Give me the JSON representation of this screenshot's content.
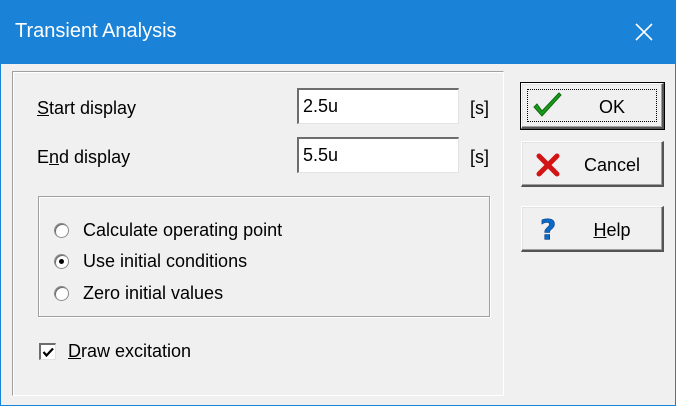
{
  "window": {
    "title": "Transient Analysis",
    "close_glyph": "✕",
    "accent": "#1a82d7"
  },
  "fields": {
    "start_display": {
      "label_hotkey": "S",
      "label_rest": "tart display",
      "value": "2.5u",
      "unit": "[s]"
    },
    "end_display": {
      "label_pre": "E",
      "label_hotkey": "n",
      "label_rest": "d display",
      "value": "5.5u",
      "unit": "[s]"
    }
  },
  "initial_conditions": {
    "options": [
      {
        "label": "Calculate operating point",
        "selected": false
      },
      {
        "label": "Use initial conditions",
        "selected": true
      },
      {
        "label": "Zero initial values",
        "selected": false
      }
    ]
  },
  "draw_excitation": {
    "label_hotkey": "D",
    "label_rest": "raw excitation",
    "checked": true
  },
  "buttons": {
    "ok": {
      "label": "OK",
      "icon": "green-check-icon"
    },
    "cancel": {
      "label": "Cancel",
      "icon": "red-x-icon"
    },
    "help": {
      "label_hotkey": "H",
      "label_rest": "elp",
      "icon": "question-mark-icon"
    }
  }
}
